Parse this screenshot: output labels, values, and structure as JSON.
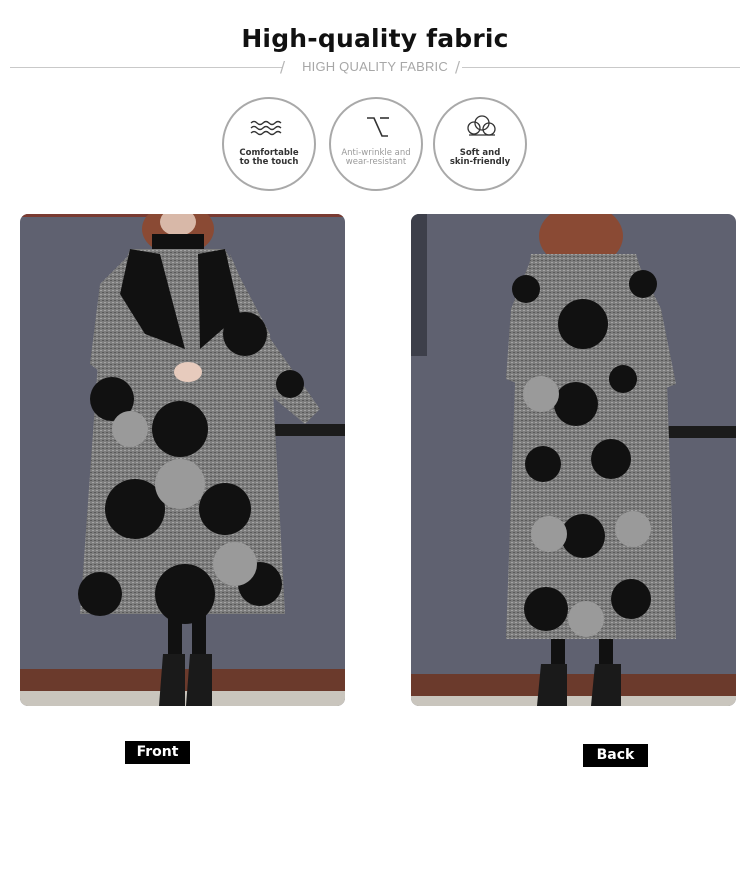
{
  "header": {
    "title": "High-quality fabric",
    "subtitle": "HIGH QUALITY FABRIC"
  },
  "features": [
    {
      "icon": "waves-icon",
      "line1": "Comfortable",
      "line2": "to the touch"
    },
    {
      "icon": "wrinkle-line-icon",
      "line1": "Anti-wrinkle and",
      "line2": "wear-resistant"
    },
    {
      "icon": "cloud-icon",
      "line1": "Soft and",
      "line2": "skin-friendly"
    }
  ],
  "photos": {
    "front_label": "Front",
    "back_label": "Back"
  },
  "colors": {
    "wall": "#5f6170",
    "coat_dark": "#111111",
    "coat_gray": "#8a8a8a",
    "floor": "#6b3a2c",
    "tag_bg": "#000000"
  }
}
